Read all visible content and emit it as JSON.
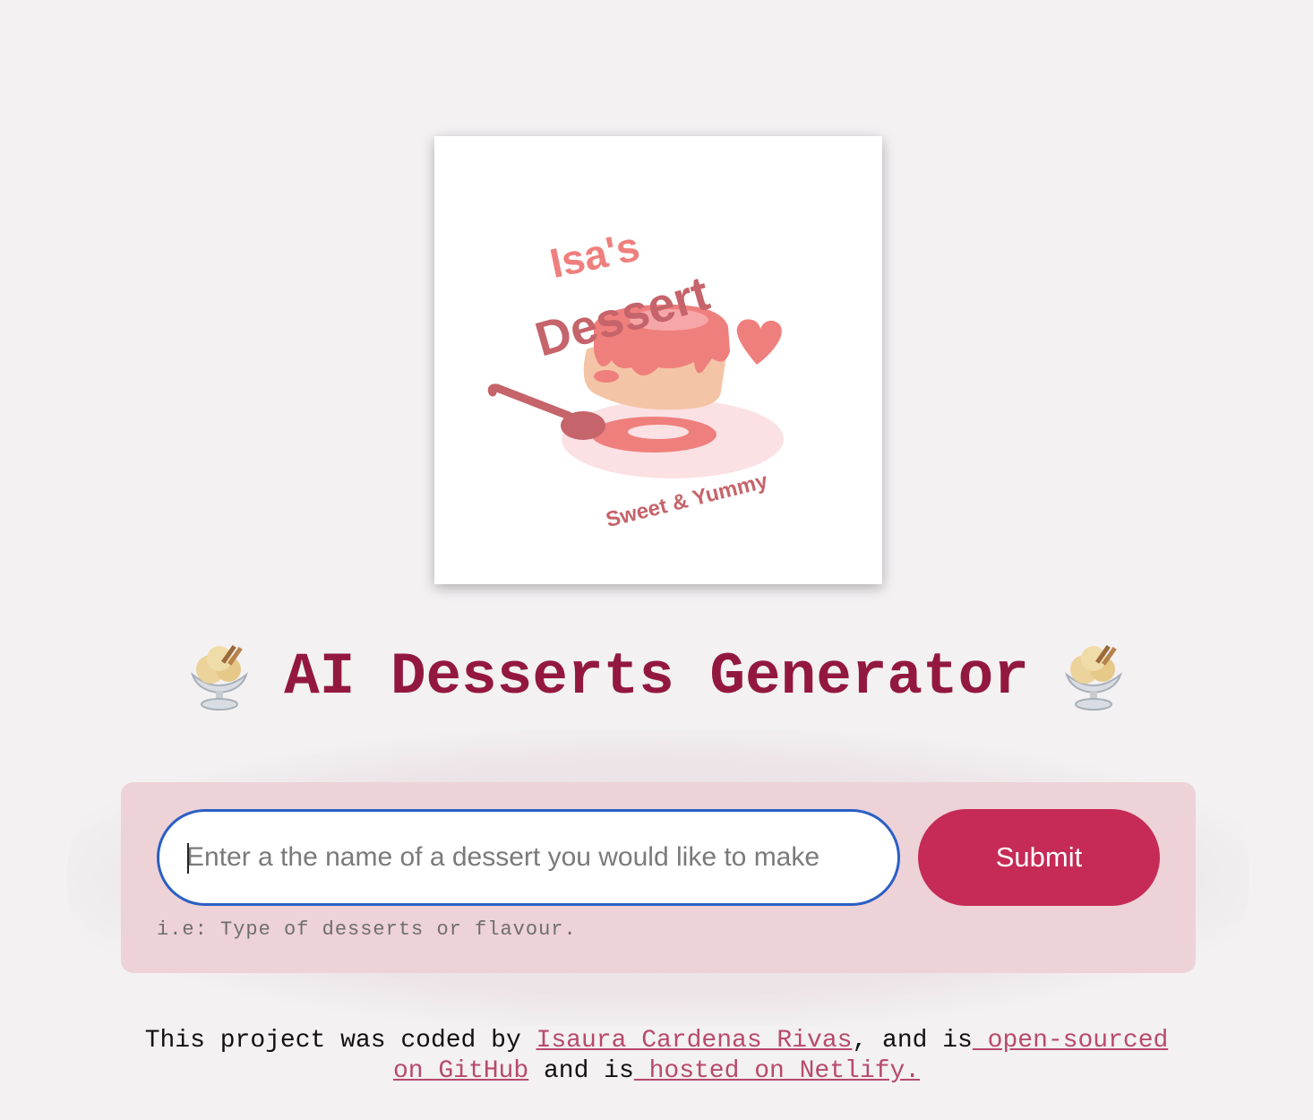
{
  "logo": {
    "line1": "Isa's",
    "line2": "Dessert",
    "tagline": "Sweet & Yummy",
    "colors": {
      "primary": "#ef7f7d",
      "dark": "#c5646a",
      "cream": "#f4c4a6",
      "plate": "#fbe1e3"
    }
  },
  "header": {
    "title": "AI Desserts Generator",
    "left_icon": "ice-cream-icon",
    "right_icon": "ice-cream-icon"
  },
  "form": {
    "input_value": "",
    "input_placeholder": "Enter a the name of a dessert you would like to make",
    "submit_label": "Submit",
    "hint": "i.e: Type of desserts or flavour."
  },
  "footer": {
    "text_1": "This project was coded by ",
    "author_link": "Isaura Cardenas Rivas",
    "text_2": ", and is",
    "github_link": " open-sourced on GitHub",
    "text_3": " and is",
    "netlify_link": " hosted on Netlify."
  },
  "colors": {
    "background": "#f3f1f2",
    "title": "#93183f",
    "form_background": "#edd2d8",
    "submit": "#c62a56",
    "link": "#b84a6c",
    "input_focus": "#2a5fc4"
  }
}
